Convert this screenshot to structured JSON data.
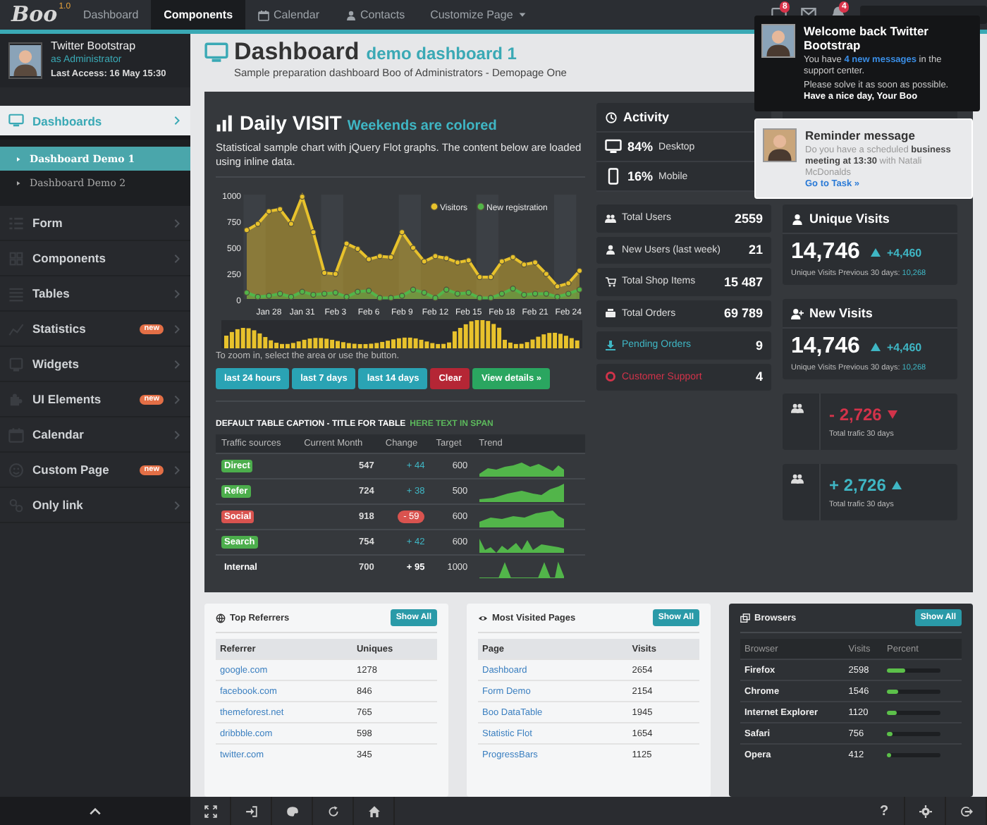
{
  "navbar": {
    "logo": "Boo",
    "version": "1.0",
    "items": [
      {
        "label": "Dashboard",
        "kind": "plain",
        "selected": false
      },
      {
        "label": "Components",
        "kind": "plain",
        "selected": true
      },
      {
        "label": "Calendar",
        "kind": "calendar",
        "selected": false
      },
      {
        "label": "Contacts",
        "kind": "person",
        "selected": false
      },
      {
        "label": "Customize Page",
        "kind": "dropdown",
        "selected": false
      }
    ],
    "notifications": [
      {
        "kind": "inbox",
        "badge": "8"
      },
      {
        "kind": "envelope"
      },
      {
        "kind": "bell",
        "badge": "4"
      }
    ]
  },
  "user": {
    "name": "Twitter Bootstrap",
    "role": "as Administrator",
    "last_access": "Last Access: 16 May 15:30"
  },
  "header": {
    "title": "Dashboard",
    "subtitle": "demo dashboard 1",
    "description": "Sample preparation dashboard Boo of Administrators - Demopage One"
  },
  "sidebar": {
    "items": [
      {
        "label": "Dashboards",
        "kind": "monitor",
        "selected": true,
        "expanded": true,
        "children": [
          {
            "label": "Dashboard Demo 1",
            "selected": true
          },
          {
            "label": "Dashboard Demo 2",
            "selected": false
          }
        ]
      },
      {
        "label": "Form",
        "kind": "form",
        "selected": false
      },
      {
        "label": "Components",
        "kind": "grid",
        "selected": false
      },
      {
        "label": "Tables",
        "kind": "tables",
        "selected": false
      },
      {
        "label": "Statistics",
        "kind": "chart",
        "selected": false,
        "badge": "new"
      },
      {
        "label": "Widgets",
        "kind": "widget",
        "selected": false
      },
      {
        "label": "UI Elements",
        "kind": "puzzle",
        "selected": false,
        "badge": "new"
      },
      {
        "label": "Calendar",
        "kind": "calendar",
        "selected": false
      },
      {
        "label": "Custom Page",
        "kind": "smile",
        "selected": false,
        "badge": "new"
      },
      {
        "label": "Only link",
        "kind": "link",
        "selected": false
      }
    ]
  },
  "daily_visit": {
    "title": "Daily VISIT",
    "subtitle": "Weekends are colored",
    "description": "Statistical sample chart with jQuery Flot graphs. The content below are loaded using inline data.",
    "chart_data": {
      "type": "area",
      "categories": [
        null,
        null,
        "Jan 28",
        null,
        null,
        "Jan 31",
        null,
        null,
        "Feb 3",
        null,
        null,
        "Feb 6",
        null,
        null,
        "Feb 9",
        null,
        null,
        "Feb 12",
        null,
        null,
        "Feb 15",
        null,
        null,
        "Feb 18",
        null,
        null,
        "Feb 21",
        null,
        null,
        "Feb 24",
        null
      ],
      "legend": "top-right",
      "series": [
        {
          "name": "Visitors",
          "color": "#e8c22c",
          "values": [
            660,
            720,
            840,
            860,
            720,
            980,
            640,
            250,
            240,
            530,
            480,
            380,
            410,
            400,
            640,
            490,
            360,
            410,
            390,
            350,
            370,
            210,
            210,
            360,
            400,
            330,
            350,
            240,
            120,
            150,
            270
          ]
        },
        {
          "name": "New registration",
          "color": "#52b54a",
          "values": [
            60,
            20,
            30,
            50,
            20,
            70,
            40,
            50,
            60,
            20,
            70,
            80,
            10,
            10,
            30,
            90,
            60,
            10,
            90,
            50,
            60,
            10,
            10,
            50,
            100,
            40,
            50,
            50,
            20,
            50,
            90
          ]
        }
      ],
      "ylim": [
        0,
        1000
      ],
      "yticks": [
        0,
        250,
        500,
        750,
        1000
      ]
    },
    "zoom_hint": "To zoom in, select the area or use the button.",
    "buttons": [
      {
        "label": "last 24 hours",
        "kind": "info"
      },
      {
        "label": "last 7 days",
        "kind": "info"
      },
      {
        "label": "last 14 days",
        "kind": "info"
      },
      {
        "label": "Clear",
        "kind": "danger"
      },
      {
        "label": "View details »",
        "kind": "success"
      }
    ]
  },
  "traffic_table": {
    "caption": "DEFAULT TABLE CAPTION - TITLE FOR TABLE",
    "caption_note": "HERE TEXT IN SPAN",
    "columns": [
      "Traffic sources",
      "Current Month",
      "Change",
      "Target",
      "Trend"
    ],
    "rows": [
      {
        "source": "Direct",
        "color": "#4cae4c",
        "month": "547",
        "change": "+ 44",
        "kind": "up",
        "target": "600"
      },
      {
        "source": "Refer",
        "color": "#4cae4c",
        "month": "724",
        "change": "+ 38",
        "kind": "up",
        "target": "500"
      },
      {
        "source": "Social",
        "color": "#d9534f",
        "month": "918",
        "change": "- 59",
        "kind": "down",
        "target": "600"
      },
      {
        "source": "Search",
        "color": "#4cae4c",
        "month": "754",
        "change": "+ 42",
        "kind": "up",
        "target": "600"
      },
      {
        "source": "Internal",
        "month": "700",
        "change": "+ 95",
        "kind": "plain",
        "target": "1000"
      }
    ]
  },
  "activity": {
    "title": "Activity",
    "devices": [
      {
        "kind": "desktop",
        "percent": "84%",
        "label": "Desktop"
      },
      {
        "kind": "mobile",
        "percent": "16%",
        "label": "Mobile"
      }
    ]
  },
  "stats": [
    {
      "kind": "users",
      "label": "Total Users",
      "value": "2559"
    },
    {
      "kind": "person",
      "label": "New Users (last week)",
      "value": "21"
    },
    {
      "kind": "cart",
      "label": "Total Shop Items",
      "value": "15 487"
    },
    {
      "kind": "box",
      "label": "Total Orders",
      "value": "69 789"
    },
    {
      "kind": "download",
      "label": "Pending Orders",
      "value": "9",
      "color": "#3fb6c4"
    },
    {
      "kind": "lifebuoy",
      "label": "Customer Support",
      "value": "4",
      "color": "#d2334a"
    }
  ],
  "visits": [
    {
      "kind": "person",
      "title": "Unique Visits",
      "value": "14,746",
      "delta": "+4,460",
      "note": "Unique Visits Previous 30 days:",
      "note_value": "10,268"
    },
    {
      "kind": "user-plus",
      "title": "New Visits",
      "value": "14,746",
      "delta": "+4,460",
      "note": "Unique Visits Previous 30 days:",
      "note_value": "10,268"
    }
  ],
  "traffic_cards": [
    {
      "value": "- 2,726",
      "kind": "down",
      "note": "Total trafic 30 days"
    },
    {
      "value": "+ 2,726",
      "kind": "up",
      "note": "Total trafic 30 days"
    }
  ],
  "referrers": {
    "title": "Top Referrers",
    "button": "Show All",
    "columns": [
      "Referrer",
      "Uniques"
    ],
    "rows": [
      [
        "google.com",
        "1278"
      ],
      [
        "facebook.com",
        "846"
      ],
      [
        "themeforest.net",
        "765"
      ],
      [
        "dribbble.com",
        "598"
      ],
      [
        "twitter.com",
        "345"
      ]
    ]
  },
  "pages": {
    "title": "Most Visited Pages",
    "button": "Show All",
    "columns": [
      "Page",
      "Visits"
    ],
    "rows": [
      [
        "Dashboard",
        "2654"
      ],
      [
        "Form Demo",
        "2154"
      ],
      [
        "Boo DataTable",
        "1945"
      ],
      [
        "Statistic Flot",
        "1654"
      ],
      [
        "ProgressBars",
        "1125"
      ]
    ]
  },
  "browsers": {
    "title": "Browsers",
    "button": "Show All",
    "columns": [
      "Browser",
      "Visits",
      "Percent"
    ],
    "rows": [
      {
        "name": "Firefox",
        "visits": "2598",
        "level": 0.35
      },
      {
        "name": "Chrome",
        "visits": "1546",
        "level": 0.2
      },
      {
        "name": "Internet Explorer",
        "visits": "1120",
        "level": 0.18
      },
      {
        "name": "Safari",
        "visits": "756",
        "level": 0.1
      },
      {
        "name": "Opera",
        "visits": "412",
        "level": 0.07
      }
    ]
  },
  "toasts": [
    {
      "kind": "dark",
      "title": "Welcome back Twitter Bootstrap",
      "before": "You have ",
      "link": "4 new messages",
      "after": " in the support center.",
      "note": "Please solve it as soon as possible.",
      "signoff": "Have a nice day, Your Boo"
    },
    {
      "kind": "light",
      "title": "Reminder message",
      "message": "Do you have a scheduled **business meeting at 13:30** with Natali McDonalds",
      "link": "Go to Task »"
    }
  ],
  "footer": {
    "help": "?"
  }
}
